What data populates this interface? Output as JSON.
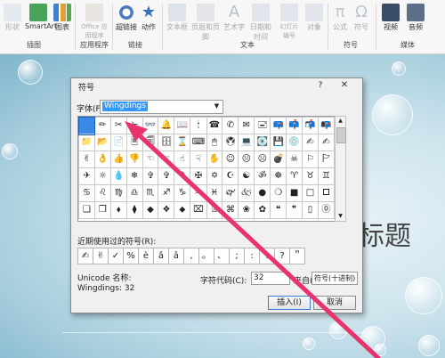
{
  "ribbon": {
    "buttons": [
      {
        "label": "形状",
        "disabled": true
      },
      {
        "label": "SmartArt",
        "disabled": false
      },
      {
        "label": "图表",
        "disabled": false
      },
      {
        "label": "Office 应用程序",
        "disabled": true
      },
      {
        "label": "超链接",
        "disabled": false
      },
      {
        "label": "动作",
        "disabled": false
      },
      {
        "label": "文本框",
        "disabled": true
      },
      {
        "label": "页眉和页脚",
        "disabled": true
      },
      {
        "label": "艺术字",
        "disabled": true
      },
      {
        "label": "日期和时间",
        "disabled": true
      },
      {
        "label": "幻灯片 编号",
        "disabled": true
      },
      {
        "label": "对象",
        "disabled": true
      },
      {
        "label": "公式",
        "disabled": true
      },
      {
        "label": "符号",
        "disabled": true
      },
      {
        "label": "视频",
        "disabled": false
      },
      {
        "label": "音频",
        "disabled": false
      }
    ],
    "groups": [
      "插图",
      "应用程序",
      "链接",
      "文本",
      "符号",
      "媒体"
    ]
  },
  "slide": {
    "title_fragment": "标题"
  },
  "dialog": {
    "title": "符号",
    "help": "?",
    "close": "✕",
    "font_label": "字体(F):",
    "font_value": "Wingdings",
    "grid_rows": [
      [
        " ",
        "✏",
        "✂",
        "✁",
        "👓",
        "🔔",
        "📖",
        "🕯",
        "☎",
        "✆",
        "✉",
        "🖃",
        "📪",
        "📫",
        "📬",
        "📭"
      ],
      [
        "📁",
        "📂",
        "📄",
        "🗏",
        "🗐",
        "🗄",
        "⌛",
        "⌨",
        "🖱",
        "🖲",
        "💻",
        "💽",
        "💾",
        "💿",
        "✍",
        "✍"
      ],
      [
        "✌",
        "👌",
        "👍",
        "👎",
        "☜",
        "☞",
        "☝",
        "☟",
        "✋",
        "☺",
        "😐",
        "☹",
        "💣",
        "☠",
        "⚐",
        "🏱"
      ],
      [
        "✈",
        "☼",
        "💧",
        "❄",
        "✞",
        "✞",
        "🕈",
        "✠",
        "✡",
        "☪",
        "☯",
        "ॐ",
        "☸",
        "♈",
        "♉",
        "♊"
      ],
      [
        "♋",
        "♌",
        "♍",
        "♎",
        "♏",
        "♐",
        "♑",
        "♒",
        "♓",
        "🙰",
        "🙵",
        "●",
        "❍",
        "■",
        "□",
        "🞐"
      ],
      [
        "❑",
        "❒",
        "⬧",
        "⧫",
        "◆",
        "❖",
        "⬥",
        "⌧",
        "⍓",
        "⌘",
        "❀",
        "✿",
        "❝",
        "❞",
        "▯",
        "⓪"
      ]
    ],
    "recent_label": "近期使用过的符号(R):",
    "recent": [
      "✍",
      "✌",
      "✓",
      "%",
      "è",
      "ǎ",
      "ǎ",
      ",",
      "。",
      "、",
      ";",
      ":",
      "!",
      "?",
      "＂"
    ],
    "unicode_name_label": "Unicode 名称:",
    "unicode_name_value": "Wingdings: 32",
    "code_label": "字符代码(C):",
    "code_value": "32",
    "from_label": "来自(M):",
    "from_value": "符号(十进制)",
    "insert_button": "插入(I)",
    "cancel_button": "取消"
  },
  "colors": {
    "selection": "#3a88e8",
    "arrow": "#e8336d"
  }
}
